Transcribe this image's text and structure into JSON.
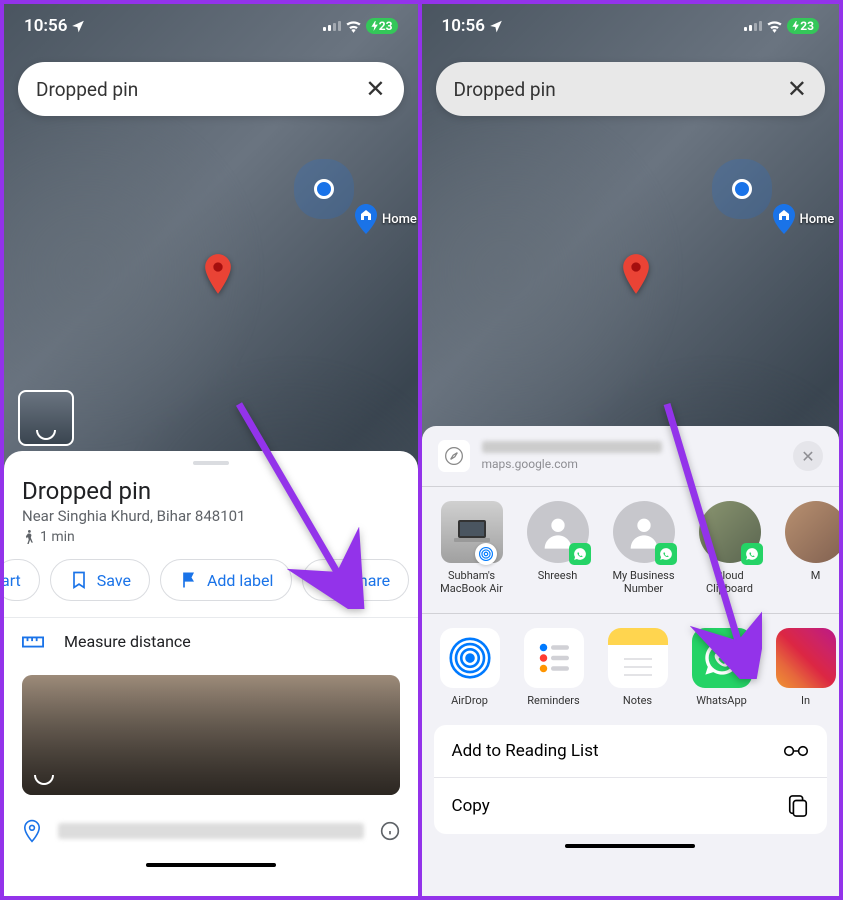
{
  "status": {
    "time": "10:56",
    "battery": "23"
  },
  "search": {
    "text": "Dropped pin"
  },
  "map": {
    "home_label": "Home"
  },
  "sheet": {
    "title": "Dropped pin",
    "subtitle": "Near Singhia Khurd, Bihar 848101",
    "walk_time": "1 min",
    "chips": {
      "start": "art",
      "save": "Save",
      "add_label": "Add label",
      "share": "Share"
    },
    "measure": "Measure distance"
  },
  "share": {
    "url": "maps.google.com",
    "contacts": [
      {
        "name": "Subham's MacBook Air",
        "type": "mac"
      },
      {
        "name": "Shreesh",
        "type": "wa"
      },
      {
        "name": "My Business Number",
        "type": "wa"
      },
      {
        "name": "Cloud Clipboard",
        "type": "photo-wa"
      },
      {
        "name": "M",
        "type": "photo"
      }
    ],
    "apps": [
      {
        "name": "AirDrop",
        "cls": "ai-airdrop"
      },
      {
        "name": "Reminders",
        "cls": "ai-reminders"
      },
      {
        "name": "Notes",
        "cls": "ai-notes"
      },
      {
        "name": "WhatsApp",
        "cls": "ai-whatsapp"
      },
      {
        "name": "In",
        "cls": "ai-insta"
      }
    ],
    "actions": {
      "reading_list": "Add to Reading List",
      "copy": "Copy"
    }
  }
}
